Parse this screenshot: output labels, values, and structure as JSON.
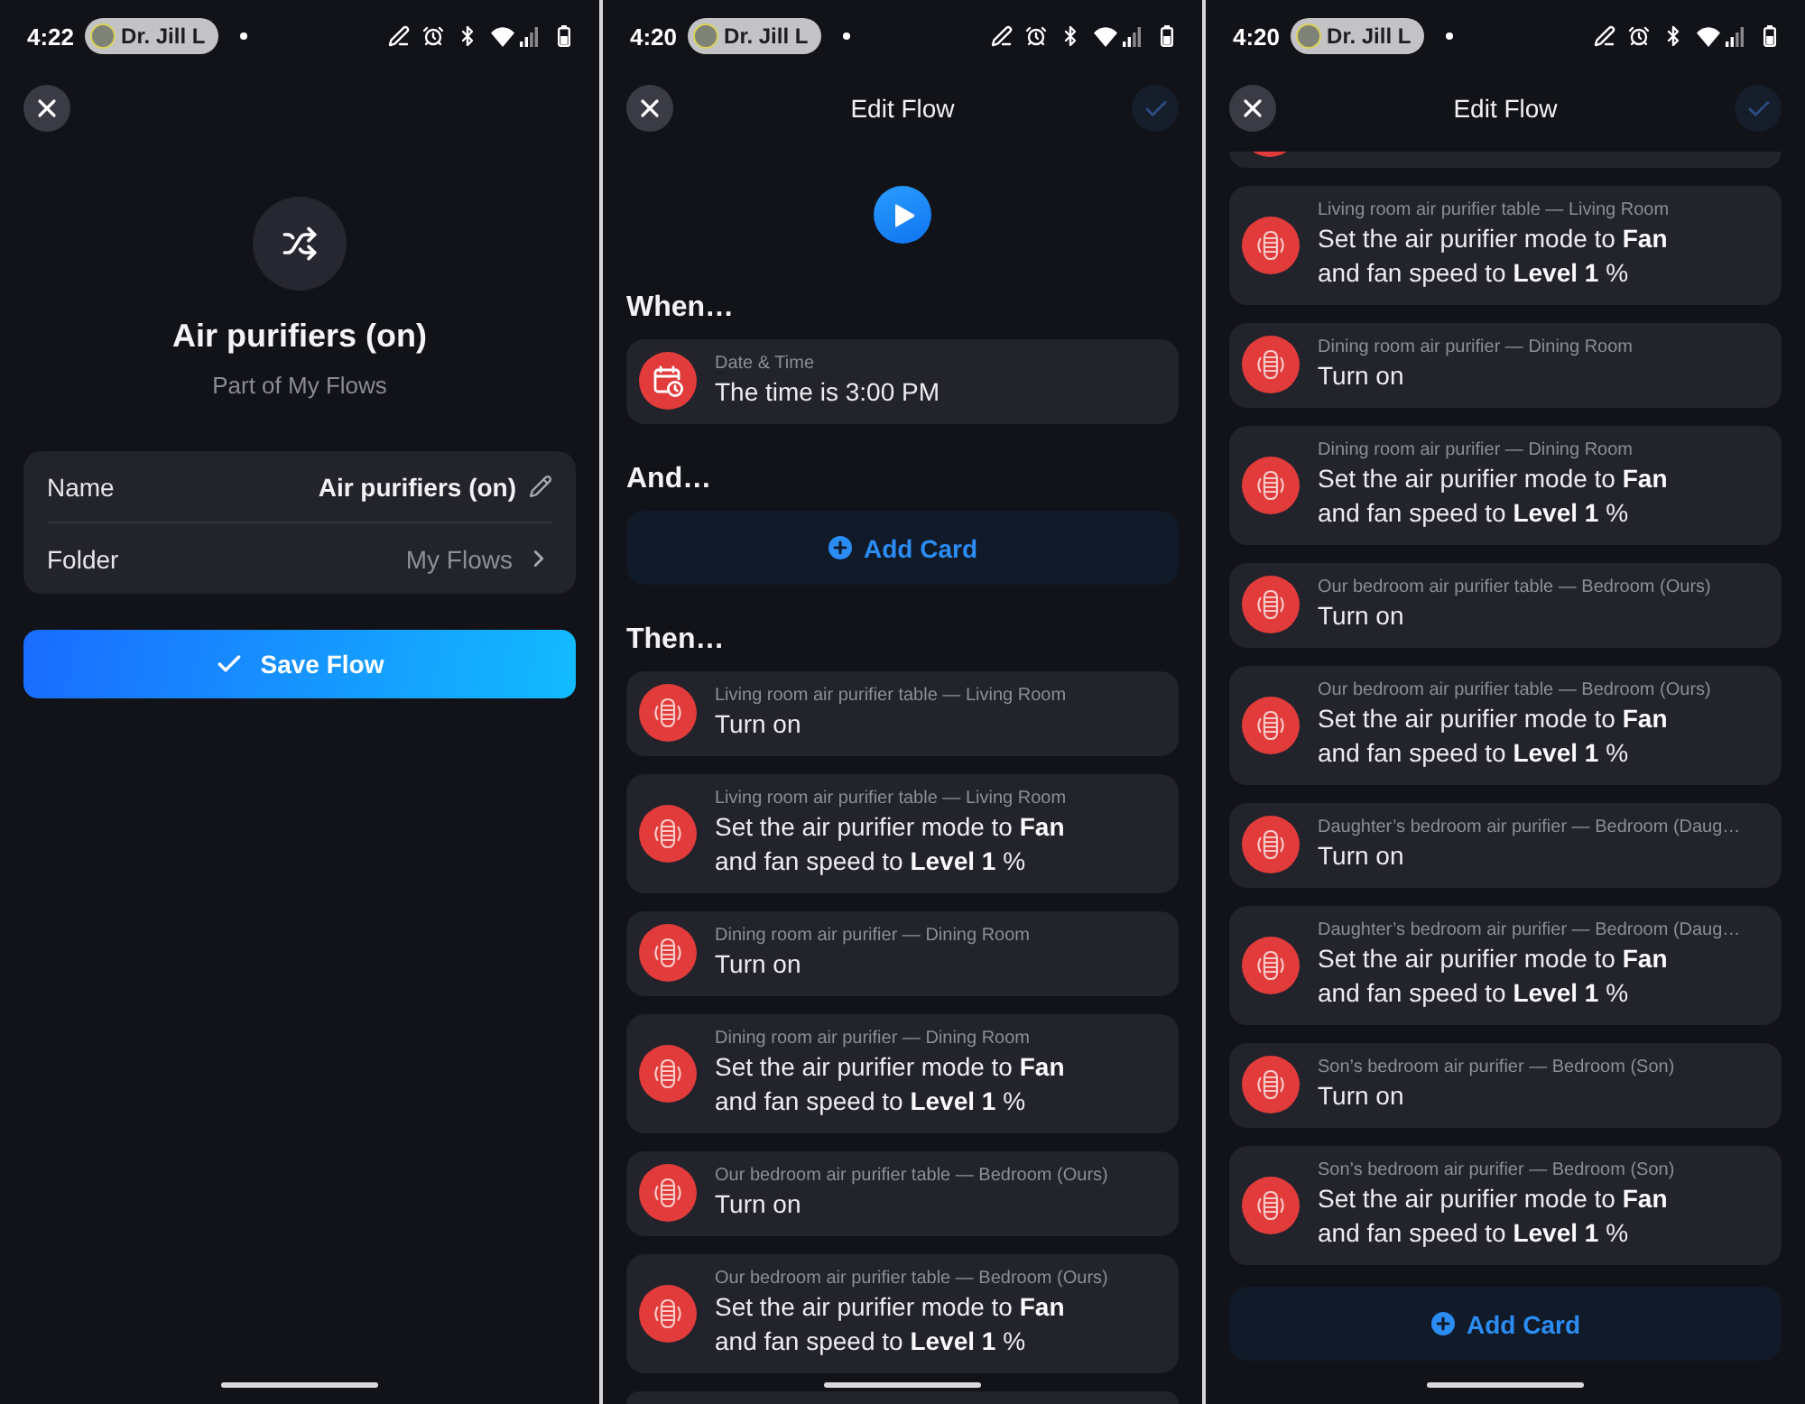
{
  "screens": [
    {
      "kind": "details",
      "status_bar": {
        "time": "4:22",
        "chip": "Dr. Jill L"
      },
      "flow": {
        "title": "Air purifiers (on)",
        "subtitle": "Part of My Flows"
      },
      "fields": [
        {
          "kind": "edit",
          "label": "Name",
          "value": "Air purifiers (on)"
        },
        {
          "kind": "link",
          "label": "Folder",
          "value": "My Flows"
        }
      ],
      "save_button": "Save Flow"
    },
    {
      "kind": "editor",
      "status_bar": {
        "time": "4:20",
        "chip": "Dr. Jill L"
      },
      "header": {
        "title": "Edit Flow",
        "confirm_disabled": true
      },
      "play_button": true,
      "sections": [
        {
          "heading": "When…",
          "cards": [
            {
              "kind": "time",
              "source": "Date & Time",
              "action": "The time is 3:00 PM"
            }
          ]
        },
        {
          "heading": "And…",
          "add_card": "Add Card"
        },
        {
          "heading": "Then…",
          "more_below": true,
          "cards": [
            {
              "kind": "device",
              "source": "Living room air purifier table — Living Room",
              "action": "Turn on"
            },
            {
              "kind": "device",
              "source": "Living room air purifier table — Living Room",
              "action": "Set the air purifier mode to **Fan**\nand fan speed to **Level 1** %"
            },
            {
              "kind": "device",
              "source": "Dining room air purifier — Dining Room",
              "action": "Turn on"
            },
            {
              "kind": "device",
              "source": "Dining room air purifier — Dining Room",
              "action": "Set the air purifier mode to **Fan**\nand fan speed to **Level 1** %"
            },
            {
              "kind": "device",
              "source": "Our bedroom air purifier table — Bedroom (Ours)",
              "action": "Turn on"
            },
            {
              "kind": "device",
              "source": "Our bedroom air purifier table — Bedroom (Ours)",
              "action": "Set the air purifier mode to **Fan**\nand fan speed to **Level 1** %"
            }
          ]
        }
      ]
    },
    {
      "kind": "editor",
      "status_bar": {
        "time": "4:20",
        "chip": "Dr. Jill L"
      },
      "header": {
        "title": "Edit Flow",
        "confirm_disabled": true
      },
      "sections": [
        {
          "more_above": true,
          "add_card": "Add Card",
          "cards": [
            {
              "kind": "device",
              "source": "Living room air purifier table — Living Room",
              "action": "Set the air purifier mode to **Fan**\nand fan speed to **Level 1** %"
            },
            {
              "kind": "device",
              "source": "Dining room air purifier — Dining Room",
              "action": "Turn on"
            },
            {
              "kind": "device",
              "source": "Dining room air purifier — Dining Room",
              "action": "Set the air purifier mode to **Fan**\nand fan speed to **Level 1** %"
            },
            {
              "kind": "device",
              "source": "Our bedroom air purifier table — Bedroom (Ours)",
              "action": "Turn on"
            },
            {
              "kind": "device",
              "source": "Our bedroom air purifier table — Bedroom (Ours)",
              "action": "Set the air purifier mode to **Fan**\nand fan speed to **Level 1** %"
            },
            {
              "kind": "device",
              "source": "Daughter’s bedroom air purifier — Bedroom (Daug…",
              "action": "Turn on"
            },
            {
              "kind": "device",
              "source": "Daughter’s bedroom air purifier — Bedroom (Daug…",
              "action": "Set the air purifier mode to **Fan**\nand fan speed to **Level 1** %"
            },
            {
              "kind": "device",
              "source": "Son’s bedroom air purifier — Bedroom (Son)",
              "action": "Turn on"
            },
            {
              "kind": "device",
              "source": "Son’s bedroom air purifier — Bedroom (Son)",
              "action": "Set the air purifier mode to **Fan**\nand fan speed to **Level 1** %"
            }
          ]
        }
      ]
    }
  ]
}
